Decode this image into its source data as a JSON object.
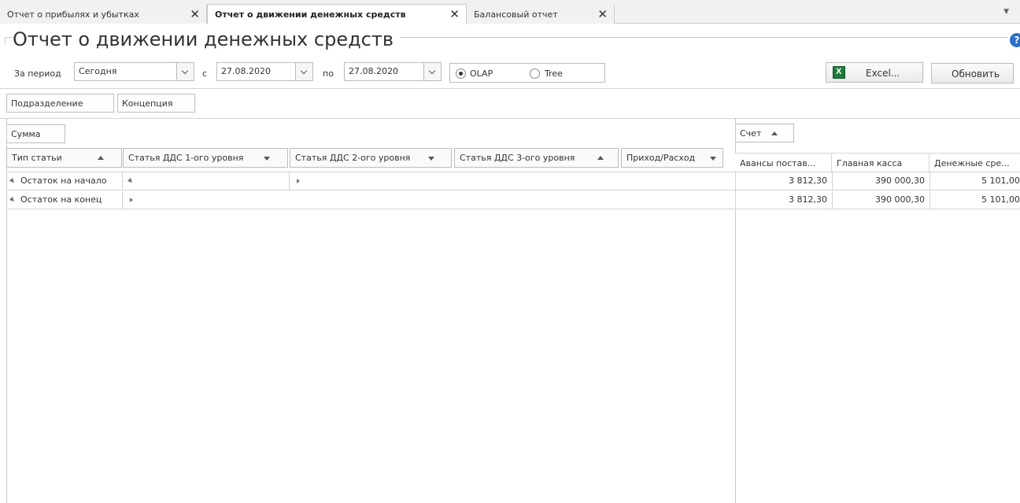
{
  "tabs": [
    {
      "label": "Отчет о прибылях и убытках",
      "close": "✕"
    },
    {
      "label": "Отчет о движении денежных средств",
      "close": "✕"
    },
    {
      "label": "Балансовый отчет",
      "close": "✕"
    }
  ],
  "tab_menu_icon": "chevron-down-icon",
  "page_title": "Отчет о движении денежных средств",
  "help_icon": "?",
  "filters": {
    "period_label": "За период",
    "period_value": "Сегодня",
    "from_label": "с",
    "from_value": "27.08.2020",
    "to_label": "по",
    "to_value": "27.08.2020",
    "mode_olap": "OLAP",
    "mode_tree": "Tree",
    "selected_mode": "OLAP"
  },
  "buttons": {
    "excel": "Excel...",
    "refresh": "Обновить"
  },
  "filter_fields": [
    "Подразделение",
    "Концепция"
  ],
  "data_field": "Сумма",
  "column_field": "Счет",
  "row_headers": [
    {
      "label": "Тип статьи",
      "sort": "asc"
    },
    {
      "label": "Статья ДДС 1-ого уровня",
      "sort": "desc"
    },
    {
      "label": "Статья ДДС 2-ого уровня",
      "sort": "desc"
    },
    {
      "label": "Статья ДДС 3-ого уровня",
      "sort": "asc"
    },
    {
      "label": "Приход/Расход",
      "sort": "desc"
    }
  ],
  "column_headers": [
    "Авансы постав...",
    "Главная касса",
    "Денежные сре..."
  ],
  "rows": [
    {
      "label": "Остаток на начало",
      "values": [
        "3 812,30",
        "390 000,30",
        "5 101,00"
      ]
    },
    {
      "label": "Остаток на конец",
      "values": [
        "3 812,30",
        "390 000,30",
        "5 101,00"
      ]
    }
  ],
  "colors": {
    "help": "#2a6fc9",
    "excel": "#1f7a3a",
    "border": "#bcbcbc"
  }
}
